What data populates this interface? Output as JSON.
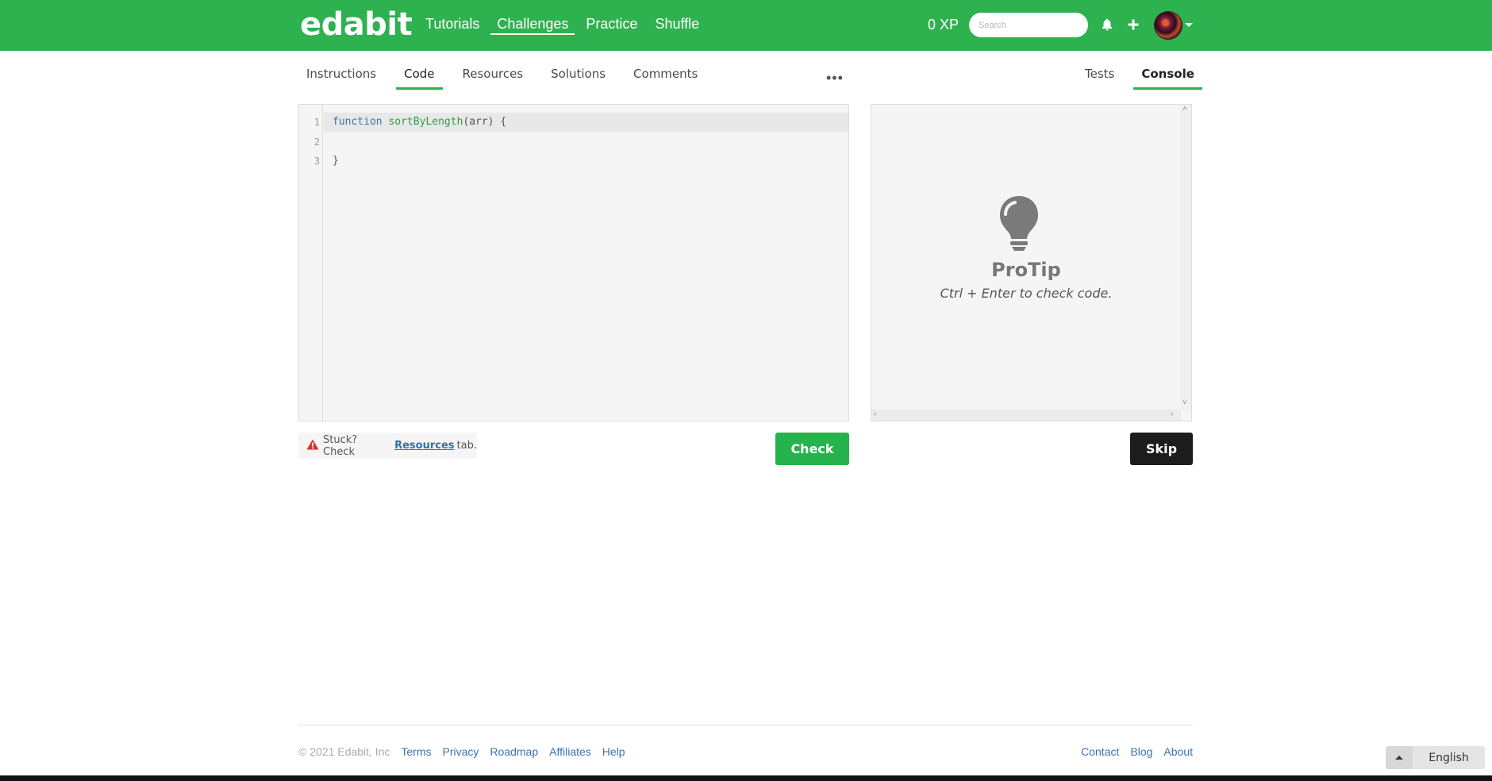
{
  "header": {
    "brand": "edabit",
    "nav": [
      "Tutorials",
      "Challenges",
      "Practice",
      "Shuffle"
    ],
    "active_nav": "Challenges",
    "xp": "0 XP",
    "search_placeholder": "Search",
    "icons": [
      "bell-icon",
      "plus-icon"
    ],
    "brand_color": "#2eb14f"
  },
  "tabs": {
    "left": [
      "Instructions",
      "Code",
      "Resources",
      "Solutions",
      "Comments"
    ],
    "active_left": "Code",
    "more": "•••",
    "right": [
      "Tests",
      "Console"
    ],
    "active_right": "Console"
  },
  "editor": {
    "line_numbers": [
      "1",
      "2",
      "3"
    ],
    "lines": [
      {
        "keyword": "function",
        "name": "sortByLength",
        "rest": "(arr) {"
      },
      {
        "text": ""
      },
      {
        "text": "}"
      }
    ]
  },
  "console": {
    "title": "ProTip",
    "text": "Ctrl + Enter to check code.",
    "icon": "lightbulb-icon"
  },
  "stuck": {
    "prefix": "Stuck? Check",
    "link": "Resources",
    "suffix": "tab."
  },
  "buttons": {
    "check": "Check",
    "skip": "Skip"
  },
  "footer": {
    "copyright": "© 2021 Edabit, Inc",
    "left_links": [
      "Terms",
      "Privacy",
      "Roadmap",
      "Affiliates",
      "Help"
    ],
    "right_links": [
      "Contact",
      "Blog",
      "About"
    ],
    "language": "English"
  }
}
